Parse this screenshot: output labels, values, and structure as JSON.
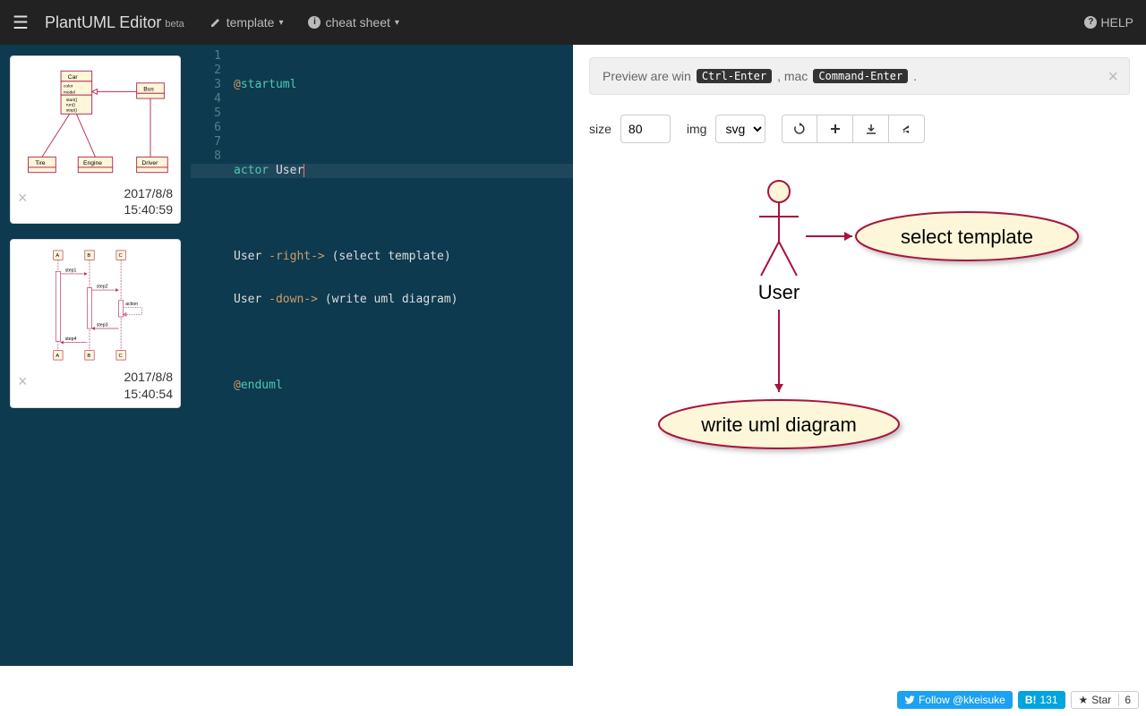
{
  "navbar": {
    "brand": "PlantUML Editor",
    "beta": "beta",
    "template": "template",
    "cheatsheet": "cheat sheet",
    "help": "HELP"
  },
  "sidebar": {
    "cards": [
      {
        "date": "2017/8/8",
        "time": "15:40:59"
      },
      {
        "date": "2017/8/8",
        "time": "15:40:54"
      }
    ]
  },
  "editor": {
    "lines": [
      "1",
      "2",
      "3",
      "4",
      "5",
      "6",
      "7",
      "8"
    ],
    "code": {
      "l1_a": "@",
      "l1_b": "startuml",
      "l3_a": "actor",
      "l3_b": " User",
      "l5_a": "User ",
      "l5_b": "-right->",
      "l5_c": " (select template)",
      "l6_a": "User ",
      "l6_b": "-down->",
      "l6_c": " (write uml diagram)",
      "l8_a": "@",
      "l8_b": "enduml"
    }
  },
  "preview": {
    "hint_pre": "Preview are win ",
    "kbd1": "Ctrl-Enter",
    "hint_mid": " , mac ",
    "kbd2": "Command-Enter",
    "hint_post": " .",
    "size_label": "size",
    "size_value": "80",
    "img_label": "img",
    "img_format": "svg"
  },
  "diagram": {
    "actor": "User",
    "usecase1": "select template",
    "usecase2": "write uml diagram"
  },
  "footer": {
    "twitter": "Follow @kkeisuke",
    "hatena_label": "B!",
    "hatena_count": "131",
    "gh_star": "Star",
    "gh_count": "6"
  },
  "thumb1": {
    "car": "Car",
    "bus": "Bus",
    "tire": "Tire",
    "engine": "Engine",
    "driver": "Driver",
    "color": "color",
    "model": "model",
    "start": "start()",
    "run": "run()",
    "stop": "stop()"
  },
  "thumb2": {
    "a": "A",
    "b": "B",
    "c": "C",
    "s1": "step1",
    "s2": "step2",
    "s3": "step3",
    "s4": "step4",
    "action": "action"
  }
}
